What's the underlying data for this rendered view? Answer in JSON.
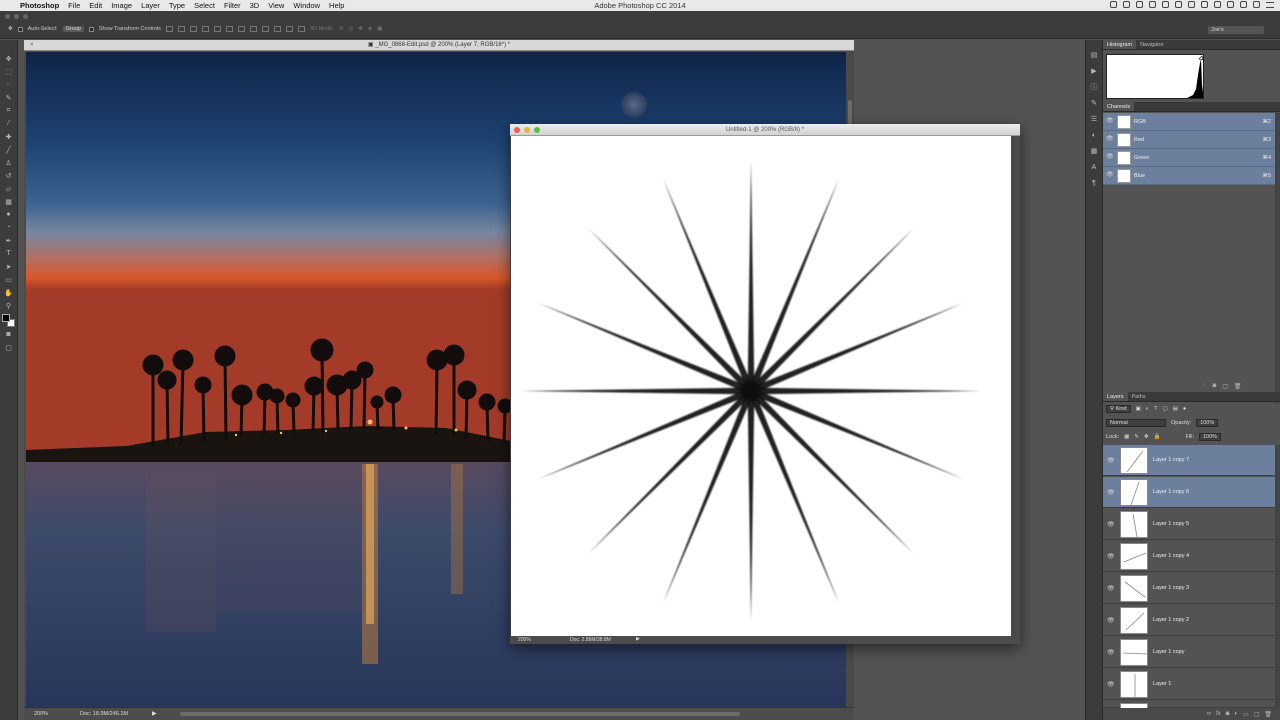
{
  "menubar": {
    "app_name": "Photoshop",
    "items": [
      "File",
      "Edit",
      "Image",
      "Layer",
      "Type",
      "Select",
      "Filter",
      "3D",
      "View",
      "Window",
      "Help"
    ],
    "window_title": "Adobe Photoshop CC 2014"
  },
  "options_bar": {
    "auto_select_label": "Auto-Select:",
    "auto_select_value": "Group",
    "transform_controls_label": "Show Transform Controls",
    "mode_3d_label": "3D Mode:",
    "workspace": "Joe's"
  },
  "toolbar": {
    "tools": [
      "move-tool",
      "marquee-tool",
      "lasso-tool",
      "quick-select-tool",
      "crop-tool",
      "eyedropper-tool",
      "healing-tool",
      "brush-tool",
      "clone-stamp-tool",
      "history-brush-tool",
      "eraser-tool",
      "gradient-tool",
      "blur-tool",
      "dodge-tool",
      "pen-tool",
      "type-tool",
      "path-select-tool",
      "shape-tool",
      "hand-tool",
      "zoom-tool"
    ],
    "type_glyph": "T",
    "foreground_color": "#000000",
    "background_color": "#ffffff"
  },
  "doc_background": {
    "tab_title": "_MG_0868-Edit.psd @ 200% (Layer 7, RGB/16*) *",
    "zoom": "200%",
    "doc_size": "Doc: 18.9M/246.1M"
  },
  "doc_floating": {
    "title": "Untitled-1 @ 200% (RGB/8) *",
    "zoom": "200%",
    "doc_size": "Doc: 2.86M/38.8M",
    "star_rays": 16
  },
  "panels": {
    "histogram_tabs": [
      "Histogram",
      "Navigator"
    ],
    "channels_title": "Channels",
    "channels": [
      {
        "name": "RGB",
        "shortcut": "⌘2"
      },
      {
        "name": "Red",
        "shortcut": "⌘3"
      },
      {
        "name": "Green",
        "shortcut": "⌘4"
      },
      {
        "name": "Blue",
        "shortcut": "⌘5"
      }
    ],
    "layers_tabs": [
      "Layers",
      "Paths"
    ],
    "kind_label": "Kind",
    "blend_mode": "Normal",
    "opacity_label": "Opacity:",
    "opacity_value": "100%",
    "lock_label": "Lock:",
    "fill_label": "Fill:",
    "fill_value": "100%",
    "layers": [
      {
        "name": "Layer 1 copy 7",
        "selected": true
      },
      {
        "name": "Layer 1 copy 6",
        "selected": true
      },
      {
        "name": "Layer 1 copy 5",
        "selected": false
      },
      {
        "name": "Layer 1 copy 4",
        "selected": false
      },
      {
        "name": "Layer 1 copy 3",
        "selected": false
      },
      {
        "name": "Layer 1 copy 2",
        "selected": false
      },
      {
        "name": "Layer 1 copy",
        "selected": false
      },
      {
        "name": "Layer 1",
        "selected": false
      }
    ]
  },
  "colors": {
    "selection_blue": "#6c7f9c",
    "panel_gray": "#535353"
  }
}
